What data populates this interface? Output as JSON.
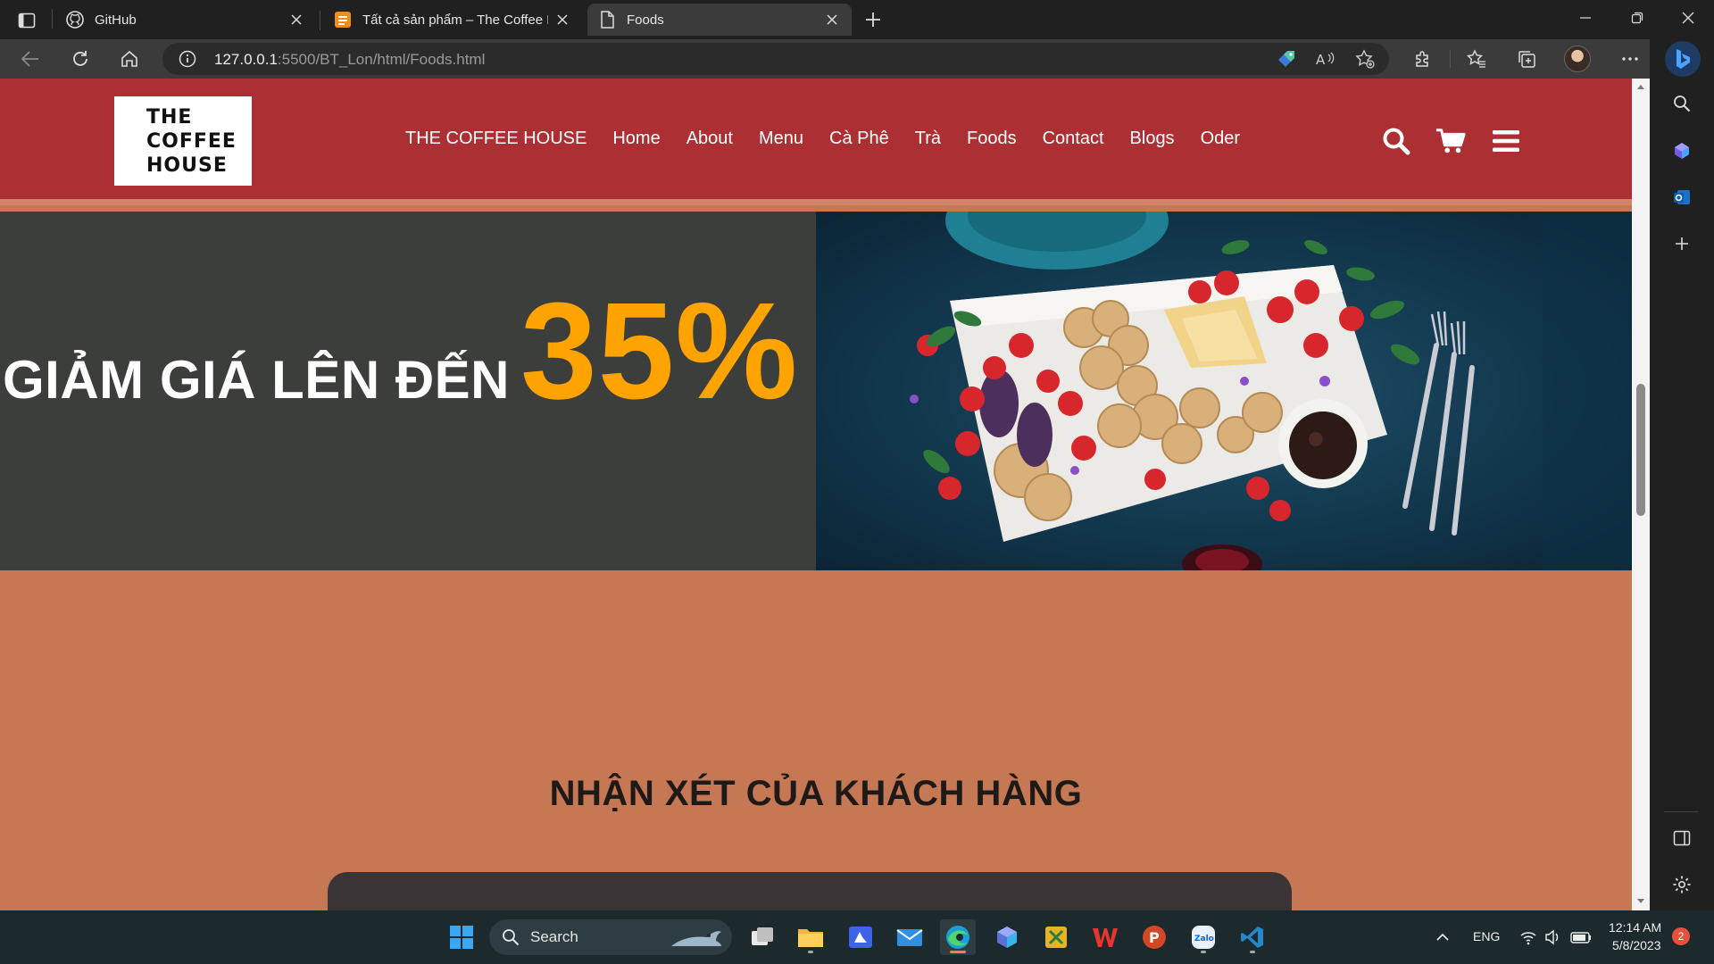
{
  "browser": {
    "tabs": [
      {
        "title": "GitHub",
        "icon": "github-icon",
        "active": false
      },
      {
        "title": "Tất cả sản phẩm – The Coffee House",
        "icon": "coffee-house-favicon",
        "active": false
      },
      {
        "title": "Foods",
        "icon": "page-icon",
        "active": true
      }
    ],
    "address": {
      "host": "127.0.0.1",
      "rest": ":5500/BT_Lon/html/Foods.html"
    }
  },
  "site": {
    "logo_text": "THE COFFEE HOUSE",
    "nav": [
      "THE COFFEE HOUSE",
      "Home",
      "About",
      "Menu",
      "Cà Phê",
      "Trà",
      "Foods",
      "Contact",
      "Blogs",
      "Oder"
    ],
    "header_icons": [
      "search-icon",
      "cart-icon",
      "menu-icon"
    ],
    "colors": {
      "header": "#ac2f33",
      "header_border": "#d28468",
      "banner_left": "#3c3e3b",
      "accent": "#ffa300",
      "page_bg": "#c67855",
      "card": "#3b3436"
    },
    "banner": {
      "lead": "GIẢM GIÁ LÊN ĐẾN",
      "highlight": "35%",
      "image": "food-platter-photo"
    },
    "reviews_title": "NHẬN XÉT CỦA KHÁCH HÀNG"
  },
  "taskbar": {
    "search_label": "Search",
    "language": "ENG",
    "time": "12:14 AM",
    "date": "5/8/2023",
    "notification_count": "2"
  }
}
